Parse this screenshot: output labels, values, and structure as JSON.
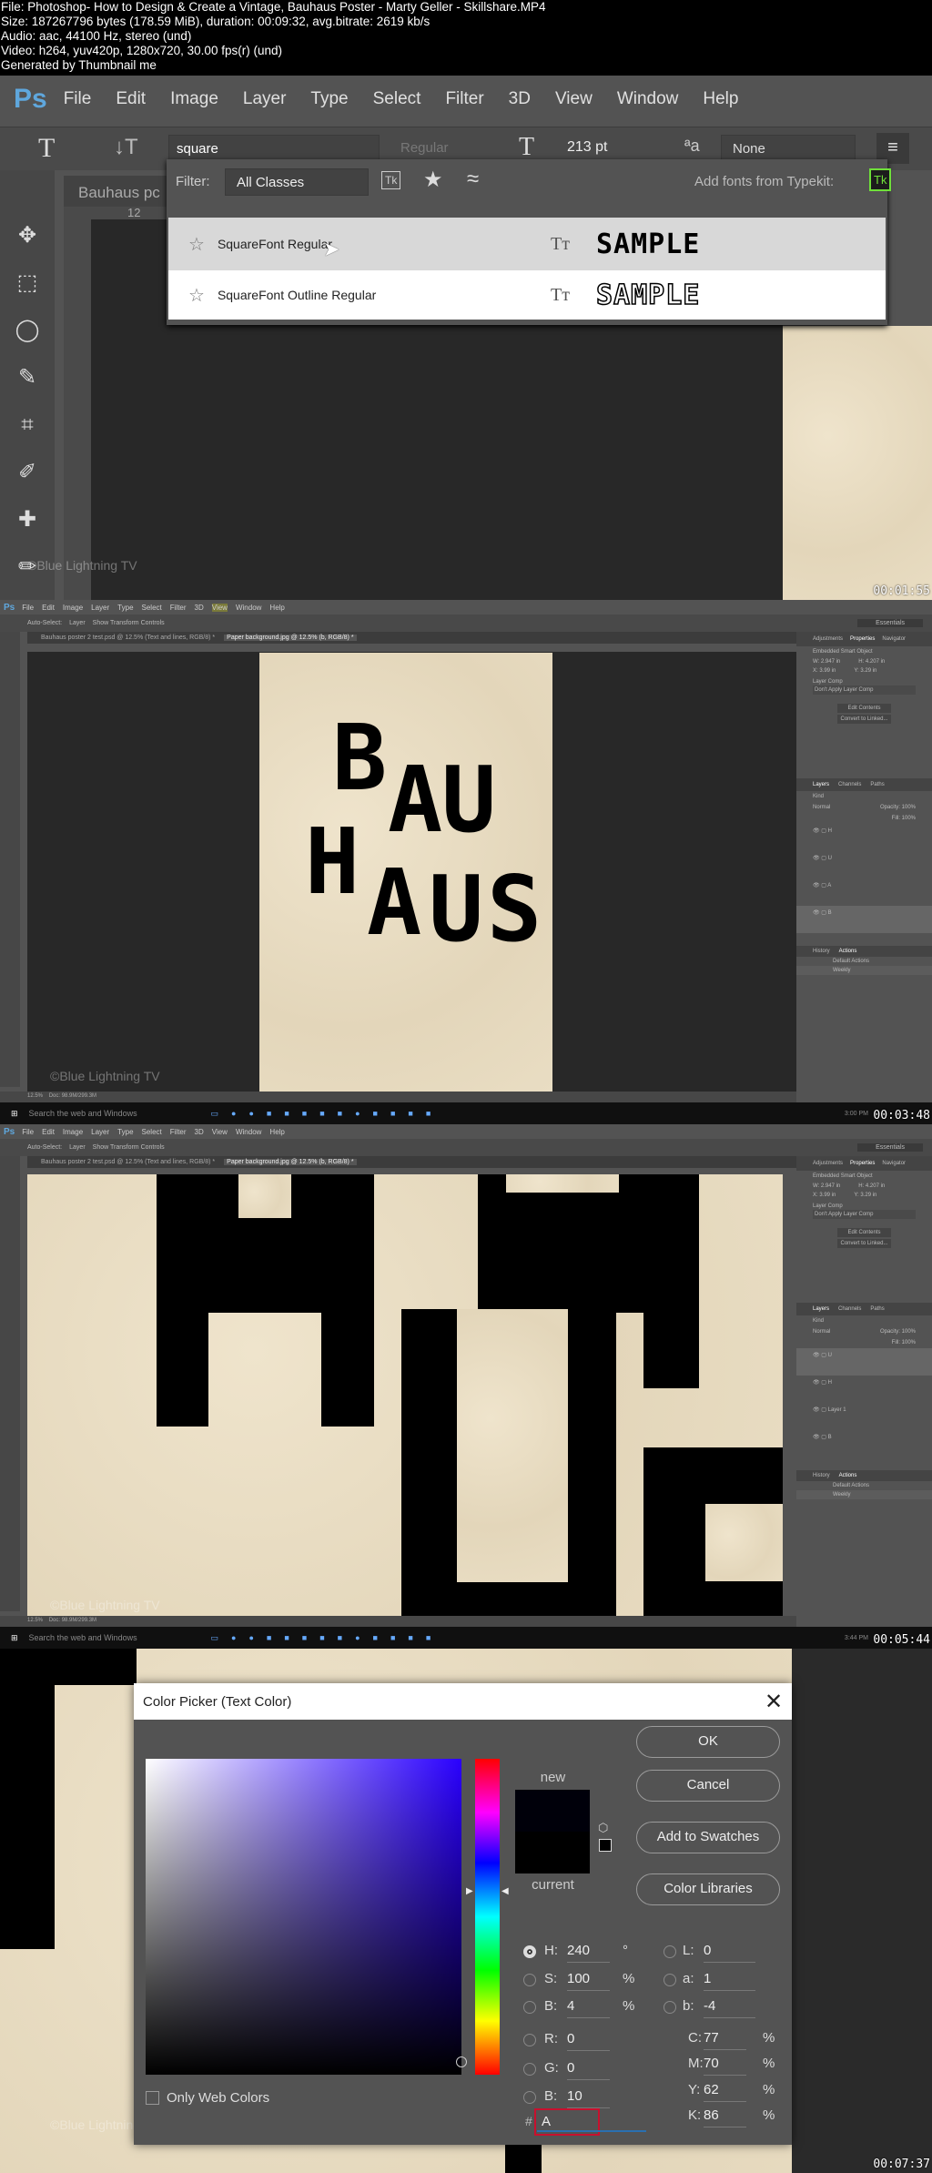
{
  "header": {
    "lines": [
      "File: Photoshop- How to Design & Create a Vintage, Bauhaus Poster - Marty Geller - Skillshare.MP4",
      "Size: 187267796 bytes (178.59 MiB), duration: 00:09:32, avg.bitrate: 2619 kb/s",
      "Audio: aac, 44100 Hz, stereo (und)",
      "Video: h264, yuv420p, 1280x720, 30.00 fps(r) (und)",
      "Generated by Thumbnail me"
    ]
  },
  "app": {
    "logo": "Ps",
    "menu": [
      "File",
      "Edit",
      "Image",
      "Layer",
      "Type",
      "Select",
      "Filter",
      "3D",
      "View",
      "Window",
      "Help"
    ]
  },
  "frame1": {
    "font_field": "square",
    "style_field": "Regular",
    "size_field": "213 pt",
    "antialias": "None",
    "doc_tab": "Bauhaus pc",
    "ruler_mark": "12",
    "font_menu": {
      "filter_label": "Filter:",
      "filter_value": "All Classes",
      "tk_label": "Tk",
      "typekit_label": "Add fonts from Typekit:",
      "fonts": [
        {
          "name": "SquareFont Regular",
          "sample": "SAMPLE",
          "highlighted": true
        },
        {
          "name": "SquareFont Outline Regular",
          "sample": "SAMPLE",
          "highlighted": false
        }
      ]
    },
    "watermark": "©Blue Lightning TV",
    "timestamp": "00:01:55"
  },
  "frame2": {
    "options": [
      "Auto-Select:",
      "Layer",
      "Show Transform Controls"
    ],
    "tabs": [
      "Bauhaus poster 2 test.psd @ 12.5% (Text and lines, RGB/8) *",
      "Paper background.jpg @ 12.5% (b, RGB/8) *"
    ],
    "poster_letters": [
      "B",
      "A",
      "U",
      "H",
      "A",
      "U",
      "S"
    ],
    "panel": {
      "tabs": [
        "Adjustments",
        "Properties",
        "Navigator"
      ],
      "object": "Embedded Smart Object",
      "w": "W: 2.947 in",
      "h": "H: 4.207 in",
      "x": "X: 3.99 in",
      "y": "Y: 3.29 in",
      "comp_label": "Layer Comp",
      "comp_value": "Don't Apply Layer Comp",
      "edit": "Edit Contents",
      "convert": "Convert to Linked...",
      "layer_tabs": [
        "Layers",
        "Channels",
        "Paths"
      ],
      "kind": "Kind",
      "blend": "Normal",
      "opacity": "Opacity: 100%",
      "fill": "Fill: 100%",
      "layers": [
        "H",
        "U",
        "A",
        "B"
      ],
      "bottom_tabs": [
        "History",
        "Actions"
      ],
      "actions": [
        "Default Actions",
        "Weekly"
      ]
    },
    "zoom": "12.5%",
    "doc": "Doc: 98.9M/299.3M",
    "search": "Search the web and Windows",
    "clock": "3:00 PM",
    "watermark": "©Blue Lightning TV",
    "timestamp": "00:03:48",
    "workspace": "Essentials"
  },
  "frame3": {
    "layers": [
      "U",
      "H",
      "Layer 1",
      "B"
    ],
    "clock": "3:44 PM",
    "watermark": "©Blue Lightning TV",
    "timestamp": "00:05:44"
  },
  "frame4": {
    "dialog": {
      "title": "Color Picker (Text Color)",
      "new_label": "new",
      "current_label": "current",
      "buttons": [
        "OK",
        "Cancel",
        "Add to Swatches",
        "Color Libraries"
      ],
      "hsb": [
        {
          "label": "H:",
          "value": "240",
          "unit": "°",
          "selected": true
        },
        {
          "label": "S:",
          "value": "100",
          "unit": "%"
        },
        {
          "label": "B:",
          "value": "4",
          "unit": "%"
        }
      ],
      "rgb": [
        {
          "label": "R:",
          "value": "0"
        },
        {
          "label": "G:",
          "value": "0"
        },
        {
          "label": "B:",
          "value": "10"
        }
      ],
      "lab": [
        {
          "label": "L:",
          "value": "0"
        },
        {
          "label": "a:",
          "value": "1"
        },
        {
          "label": "b:",
          "value": "-4"
        }
      ],
      "cmyk": [
        {
          "label": "C:",
          "value": "77",
          "unit": "%"
        },
        {
          "label": "M:",
          "value": "70",
          "unit": "%"
        },
        {
          "label": "Y:",
          "value": "62",
          "unit": "%"
        },
        {
          "label": "K:",
          "value": "86",
          "unit": "%"
        }
      ],
      "hex_label": "#",
      "hex_value": "A",
      "only_web": "Only Web Colors",
      "new_color": "#00000a",
      "current_color": "#000000"
    },
    "watermark": "©Blue Lightning TV",
    "timestamp": "00:07:37"
  }
}
